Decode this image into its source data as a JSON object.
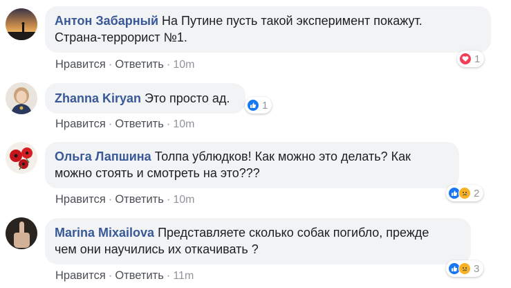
{
  "actions": {
    "like_label": "Нравится",
    "reply_label": "Ответить",
    "separator": "·"
  },
  "comments": [
    {
      "author": "Антон Забарный",
      "text_lines": [
        "На Путине пусть такой эксперимент покажут.",
        "Страна-террорист №1."
      ],
      "time": "10m",
      "reactions": [
        "love"
      ],
      "reaction_count": "1"
    },
    {
      "author": "Zhanna Kiryan",
      "text_lines": [
        "Это просто ад."
      ],
      "time": "10m",
      "reactions": [
        "like"
      ],
      "reaction_count": "1"
    },
    {
      "author": "Ольга Лапшина",
      "text_lines": [
        "Толпа ублюдков! Как можно это делать? Как",
        "можно стоять и смотреть на это???"
      ],
      "time": "10m",
      "reactions": [
        "like",
        "sad"
      ],
      "reaction_count": "2"
    },
    {
      "author": "Marina Mixailova",
      "text_lines": [
        "Представляете сколько собак погибло, прежде",
        "чем они научились их откачивать ?"
      ],
      "time": "11m",
      "reactions": [
        "like",
        "sad"
      ],
      "reaction_count": "3"
    }
  ],
  "colors": {
    "author": "#385898",
    "bubble": "#f2f3f5",
    "like": "#1877f2",
    "love": "#f33e58",
    "sad": "#f7b125"
  }
}
